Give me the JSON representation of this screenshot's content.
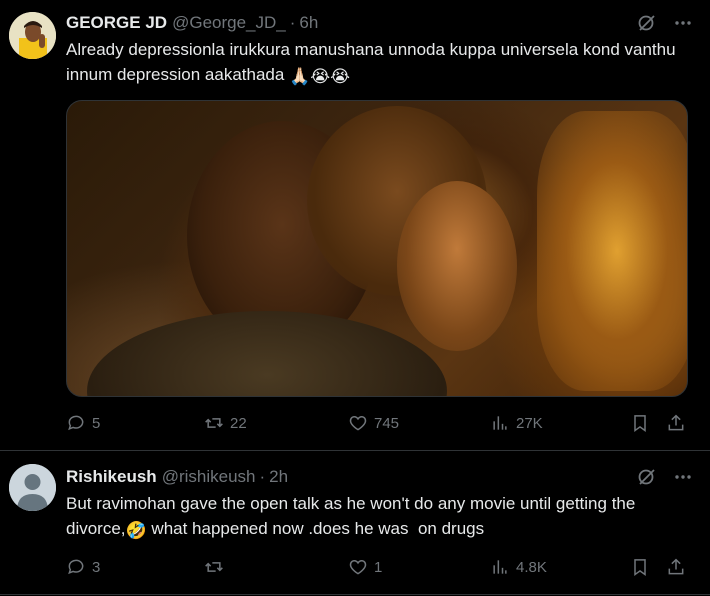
{
  "tweets": [
    {
      "name": "GEORGE JD",
      "handle": "@George_JD_",
      "separator": "·",
      "time": "6h",
      "text": "Already depressionla irukkura manushana unnoda kuppa universela kond vanthu innum depression aakathada",
      "emojis": "🙏🏻😭😭",
      "replies": "5",
      "retweets": "22",
      "likes": "745",
      "views": "27K"
    },
    {
      "name": "Rishikeush",
      "handle": "@rishikeush",
      "separator": "·",
      "time": "2h",
      "text_part1": "But ravimohan gave the open talk as he won't do any movie until getting the divorce,",
      "emoji": "🤣",
      "text_part2": " what happened now .does he was  on drugs",
      "replies": "3",
      "retweets": "",
      "likes": "1",
      "views": "4.8K"
    }
  ],
  "icons": {
    "grok": "grok-icon",
    "more": "more-icon",
    "reply": "reply-icon",
    "retweet": "retweet-icon",
    "like": "heart-icon",
    "views": "views-icon",
    "bookmark": "bookmark-icon",
    "share": "share-icon"
  },
  "colors": {
    "background": "#000000",
    "text": "#e7e9ea",
    "muted": "#71767b",
    "border": "#2f3336"
  }
}
